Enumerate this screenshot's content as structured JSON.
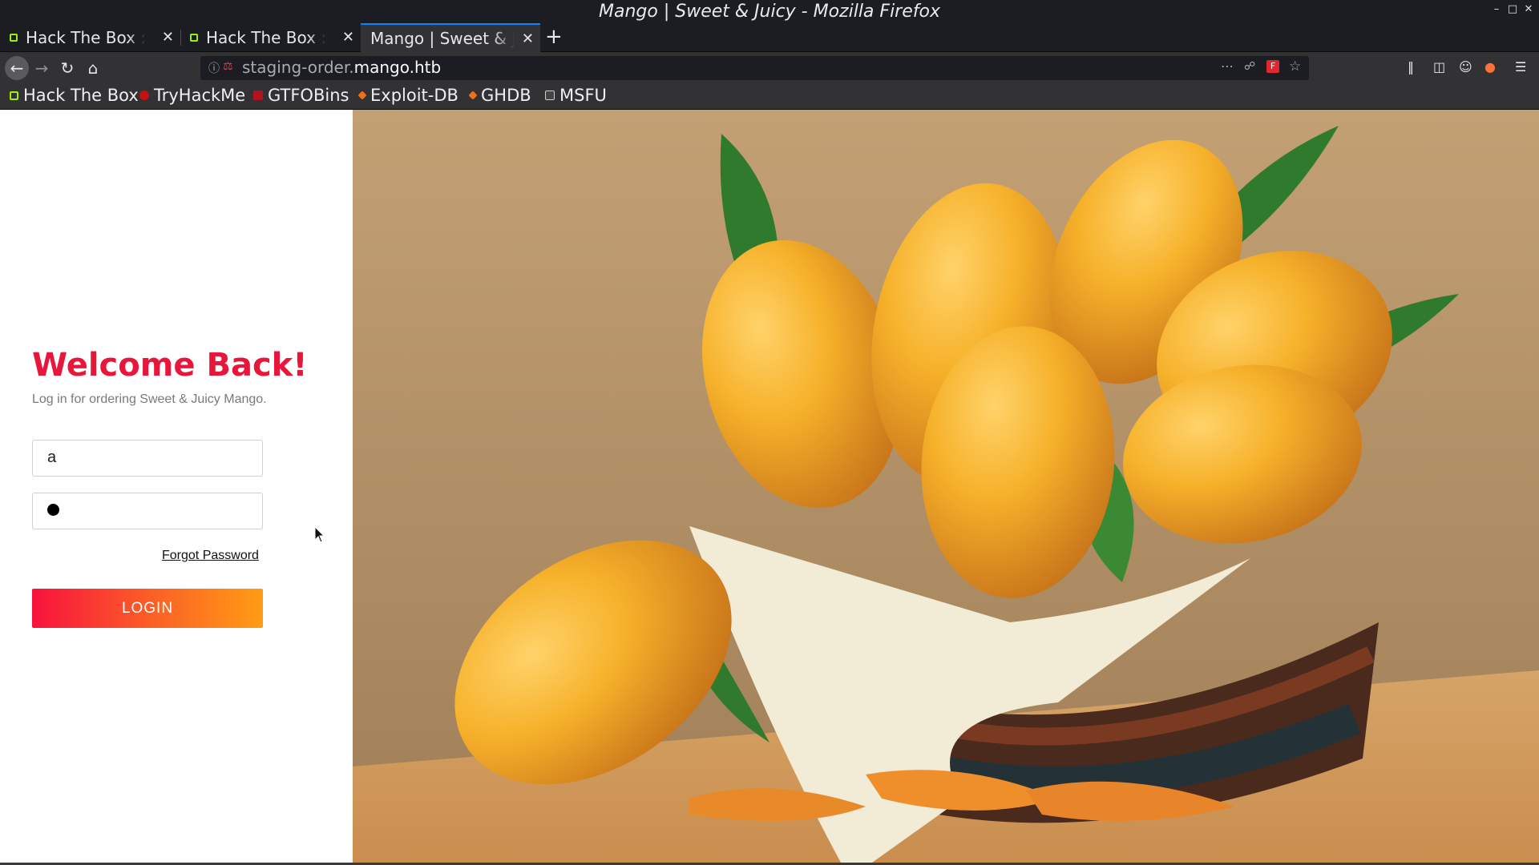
{
  "window": {
    "title": "Mango | Sweet & Juicy - Mozilla Firefox"
  },
  "tabs": [
    {
      "label": "Hack The Box :: M"
    },
    {
      "label": "Hack The Box :: M"
    },
    {
      "label": "Mango | Sweet & Ju"
    }
  ],
  "url": {
    "prefix": "staging-order.",
    "domain": "mango.htb"
  },
  "bookmarks": [
    {
      "label": "Hack The Box",
      "icon": "htb-icon",
      "color": "#9fef00"
    },
    {
      "label": "TryHackMe",
      "icon": "tryhackme-icon",
      "color": "#c11111"
    },
    {
      "label": "GTFOBins",
      "icon": "gtfobins-icon",
      "color": "#b5121b"
    },
    {
      "label": "Exploit-DB",
      "icon": "exploitdb-icon",
      "color": "#f06d1a"
    },
    {
      "label": "GHDB",
      "icon": "ghdb-icon",
      "color": "#f06d1a"
    },
    {
      "label": "MSFU",
      "icon": "msfu-icon",
      "color": "#cccccc"
    }
  ],
  "login": {
    "heading": "Welcome Back!",
    "subtitle": "Log in for ordering Sweet & Juicy Mango.",
    "username_value": "a",
    "forgot_label": "Forgot Password",
    "button_label": "LOGIN"
  },
  "colors": {
    "accent": "#e8163a",
    "gradient_start": "#f7123d",
    "gradient_end": "#ff9c14",
    "tab_highlight": "#0a84ff"
  }
}
